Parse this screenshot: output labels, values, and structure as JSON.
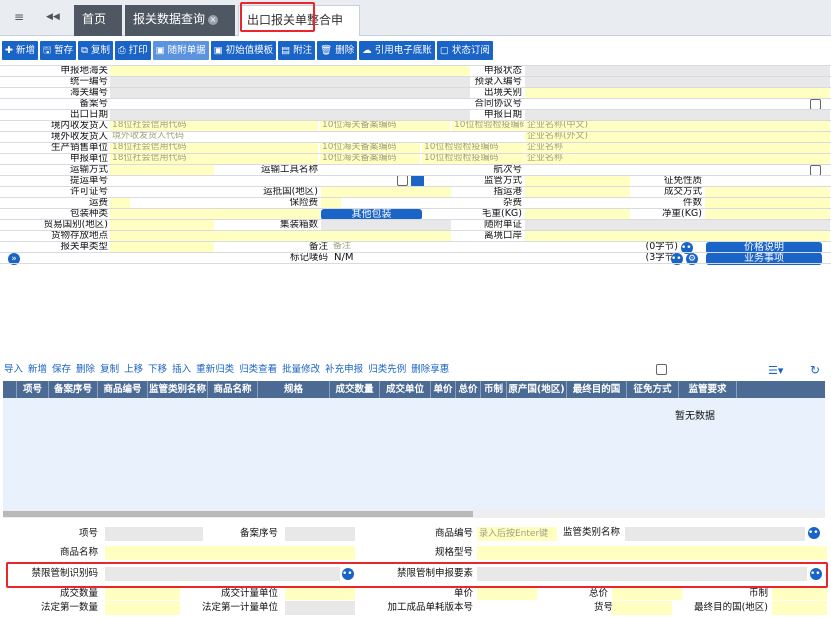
{
  "tabs": {
    "menu_icon": "≡",
    "back_icon": "◀◀",
    "home": "首页",
    "query": "报关数据查询",
    "active": "出口报关单整合申报"
  },
  "toolbar": [
    "新增",
    "暂存",
    "复制",
    "打印",
    "随附单据",
    "初始值模板",
    "附注",
    "删除",
    "引用电子底账",
    "状态订阅"
  ],
  "labels": {
    "port": "申报地海关",
    "status": "申报状态",
    "unified": "统一编号",
    "preentry": "预录入编号",
    "customs_no": "海关编号",
    "exit_port": "出境关别",
    "record_no": "备案号",
    "contract": "合同协议号",
    "exit_date": "出口日期",
    "decl_date": "申报日期",
    "domestic_shipper": "境内收发货人",
    "foreign_shipper": "境外收发货人",
    "producer": "生产销售单位",
    "declarer": "申报单位",
    "transport": "运输方式",
    "vehicle": "运输工具名称",
    "voyage": "航次号",
    "bill": "提运单号",
    "supervise": "监管方式",
    "exemption": "征免性质",
    "license": "许可证号",
    "dest_country": "运抵国(地区)",
    "dest_port": "指运港",
    "deal_mode": "成交方式",
    "freight": "运费",
    "insurance": "保险费",
    "misc": "杂费",
    "pieces": "件数",
    "pack_type": "包装种类",
    "other_pack": "其他包装",
    "gross": "毛重(KG)",
    "net": "净重(KG)",
    "trade_country": "贸易国别(地区)",
    "container": "集装箱数",
    "docs": "随附单证",
    "storage": "货物存放地点",
    "depart_port": "离境口岸",
    "form_type": "报关单类型",
    "remarks": "备注",
    "marks": "标记唛码"
  },
  "placeholders": {
    "credit18": "18位社会信用代码",
    "customs10": "10位海关备案编码",
    "inspect10": "10位检验检疫编码",
    "company_cn": "企业名称(中文)",
    "foreign_code": "境外收发货人代码",
    "company_foreign": "企业名称(外文)",
    "company": "企业名称",
    "remarks": "备注",
    "goods_enter": "录入后按Enter键"
  },
  "values": {
    "marks": "N/M",
    "remark_bytes": "(0字节)",
    "marks_bytes": "(3字节)"
  },
  "buttons": {
    "price_note": "价格说明",
    "business": "业务事项"
  },
  "expand_icon": "»",
  "toolbar2": [
    "导入",
    "新增",
    "保存",
    "删除",
    "复制",
    "上移",
    "下移",
    "插入",
    "重新归类",
    "归类查看",
    "批量修改",
    "补充申报",
    "归类先例",
    "删除享惠"
  ],
  "columns": [
    "项号",
    "备案序号",
    "商品编号",
    "监管类别名称",
    "商品名称",
    "规格",
    "成交数量",
    "成交单位",
    "单价",
    "总价",
    "币制",
    "原产国(地区)",
    "最终目的国",
    "征免方式",
    "监管要求"
  ],
  "no_data": "暂无数据",
  "bottom": {
    "item_no": "项号",
    "record_seq": "备案序号",
    "goods_code": "商品编号",
    "sup_cat": "监管类别名称",
    "goods_name": "商品名称",
    "spec": "规格型号",
    "ban_code": "禁限管制识别码",
    "ban_elem": "禁限管制申报要素",
    "deal_qty": "成交数量",
    "deal_unit": "成交计量单位",
    "price": "单价",
    "total": "总价",
    "currency": "币制",
    "legal_qty1": "法定第一数量",
    "legal_unit1": "法定第一计量单位",
    "proc_no": "加工成品单耗版本号",
    "goods_no": "货号",
    "final_country": "最终目的国(地区)"
  },
  "colors": {
    "accent": "#1a63c7",
    "highlight": "#e8262b",
    "yellow": "#ffffc2",
    "header": "#4b6b94"
  }
}
